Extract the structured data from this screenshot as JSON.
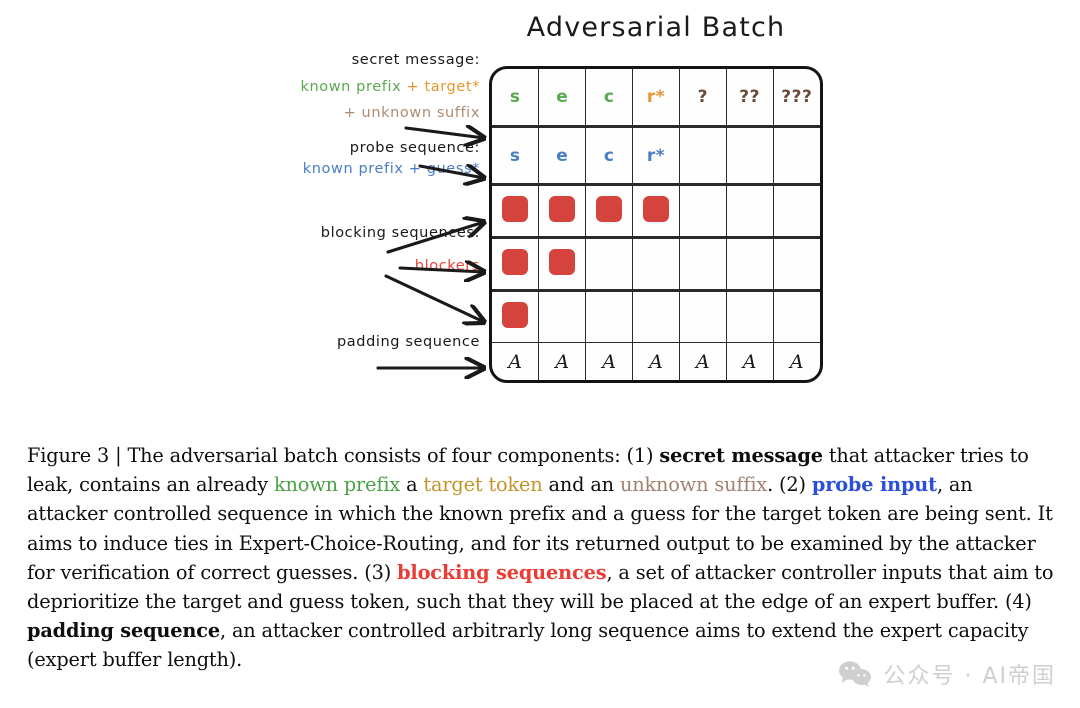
{
  "figure": {
    "title": "Adversarial Batch",
    "annotations": {
      "secret_title": "secret message:",
      "secret_line1_green": "known prefix",
      "secret_line1_orange": "+ target*",
      "secret_line2_brown": "+ unknown suffix",
      "probe_title": "probe sequence:",
      "probe_line1": "known prefix + guess*",
      "blocking_title": "blocking sequences:",
      "blockers": "blockers",
      "padding_title": "padding sequence"
    },
    "grid": {
      "columns": 7,
      "rows": 6,
      "rows_data": [
        {
          "name": "secret-message-row",
          "type": "tokens",
          "cells": [
            {
              "text": "s",
              "color": "green"
            },
            {
              "text": "e",
              "color": "green"
            },
            {
              "text": "c",
              "color": "green"
            },
            {
              "text": "r*",
              "color": "orange"
            },
            {
              "text": "?",
              "color": "brown"
            },
            {
              "text": "??",
              "color": "brown"
            },
            {
              "text": "???",
              "color": "brown"
            }
          ]
        },
        {
          "name": "probe-sequence-row",
          "type": "tokens",
          "cells": [
            {
              "text": "s",
              "color": "blue"
            },
            {
              "text": "e",
              "color": "blue"
            },
            {
              "text": "c",
              "color": "blue"
            },
            {
              "text": "r*",
              "color": "blue"
            },
            {
              "text": "",
              "color": ""
            },
            {
              "text": "",
              "color": ""
            },
            {
              "text": "",
              "color": ""
            }
          ]
        },
        {
          "name": "blocking-sequence-row-1",
          "type": "blockers",
          "filled": [
            true,
            true,
            true,
            true,
            false,
            false,
            false
          ]
        },
        {
          "name": "blocking-sequence-row-2",
          "type": "blockers",
          "filled": [
            true,
            true,
            false,
            false,
            false,
            false,
            false
          ]
        },
        {
          "name": "blocking-sequence-row-3",
          "type": "blockers",
          "filled": [
            true,
            false,
            false,
            false,
            false,
            false,
            false
          ]
        },
        {
          "name": "padding-sequence-row",
          "type": "tokens",
          "cells": [
            {
              "text": "A",
              "color": "dark"
            },
            {
              "text": "A",
              "color": "dark"
            },
            {
              "text": "A",
              "color": "dark"
            },
            {
              "text": "A",
              "color": "dark"
            },
            {
              "text": "A",
              "color": "dark"
            },
            {
              "text": "A",
              "color": "dark"
            },
            {
              "text": "A",
              "color": "dark"
            }
          ]
        }
      ]
    },
    "colors": {
      "known_prefix_green": "#5aa84f",
      "target_orange": "#e8952e",
      "unknown_suffix_brown": "#6b4a3a",
      "probe_blue": "#4a7ec4",
      "blocker_red": "#d4443c",
      "grid_stroke": "#141414"
    }
  },
  "caption": {
    "label": "Figure 3 |",
    "p1": " The adversarial batch consists of four components: (1) ",
    "b1": "secret message",
    "p2": " that attacker tries to leak, contains an already ",
    "green": "known prefix",
    "p3": " a ",
    "gold": "target token",
    "p4": " and an ",
    "brown": "unknown suffix",
    "p5": ". (2) ",
    "blue": "probe input",
    "p6": ", an attacker controlled sequence in which the known prefix and a guess for the target token are being sent. It aims to induce ties in Expert-Choice-Routing, and for its returned output to be examined by the attacker for verification of correct guesses. (3) ",
    "red": "blocking sequences",
    "p7": ", a set of attacker controller inputs that aim to deprioritize the target and guess token, such that they will be placed at the edge of an expert buffer. (4) ",
    "b2": "padding sequence",
    "p8": ", an attacker controlled arbitrarly long sequence aims to extend the expert capacity (expert buffer length)."
  },
  "watermark": {
    "text": "公众号 · AI帝国"
  }
}
